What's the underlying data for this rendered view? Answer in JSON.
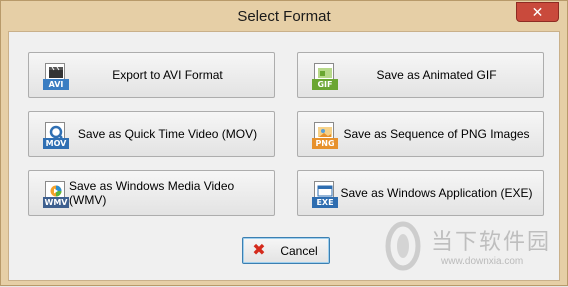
{
  "window": {
    "title": "Select Format",
    "close_label": "✕"
  },
  "buttons": [
    {
      "id": "avi",
      "label": "Export to AVI Format",
      "tag": "AVI",
      "tag_color": "#3a7dc2"
    },
    {
      "id": "gif",
      "label": "Save as Animated GIF",
      "tag": "GIF",
      "tag_color": "#6aa632"
    },
    {
      "id": "mov",
      "label": "Save as Quick Time Video (MOV)",
      "tag": "MOV",
      "tag_color": "#2f6fb3"
    },
    {
      "id": "png",
      "label": "Save as Sequence of PNG Images",
      "tag": "PNG",
      "tag_color": "#e7912c"
    },
    {
      "id": "wmv",
      "label": "Save as Windows Media Video (WMV)",
      "tag": "WMV",
      "tag_color": "#3d5f8f"
    },
    {
      "id": "exe",
      "label": "Save as Windows Application (EXE)",
      "tag": "EXE",
      "tag_color": "#2e6db0"
    }
  ],
  "cancel": {
    "label": "Cancel"
  },
  "watermark": {
    "cn": "当下软件园",
    "url": "www.downxia.com"
  }
}
